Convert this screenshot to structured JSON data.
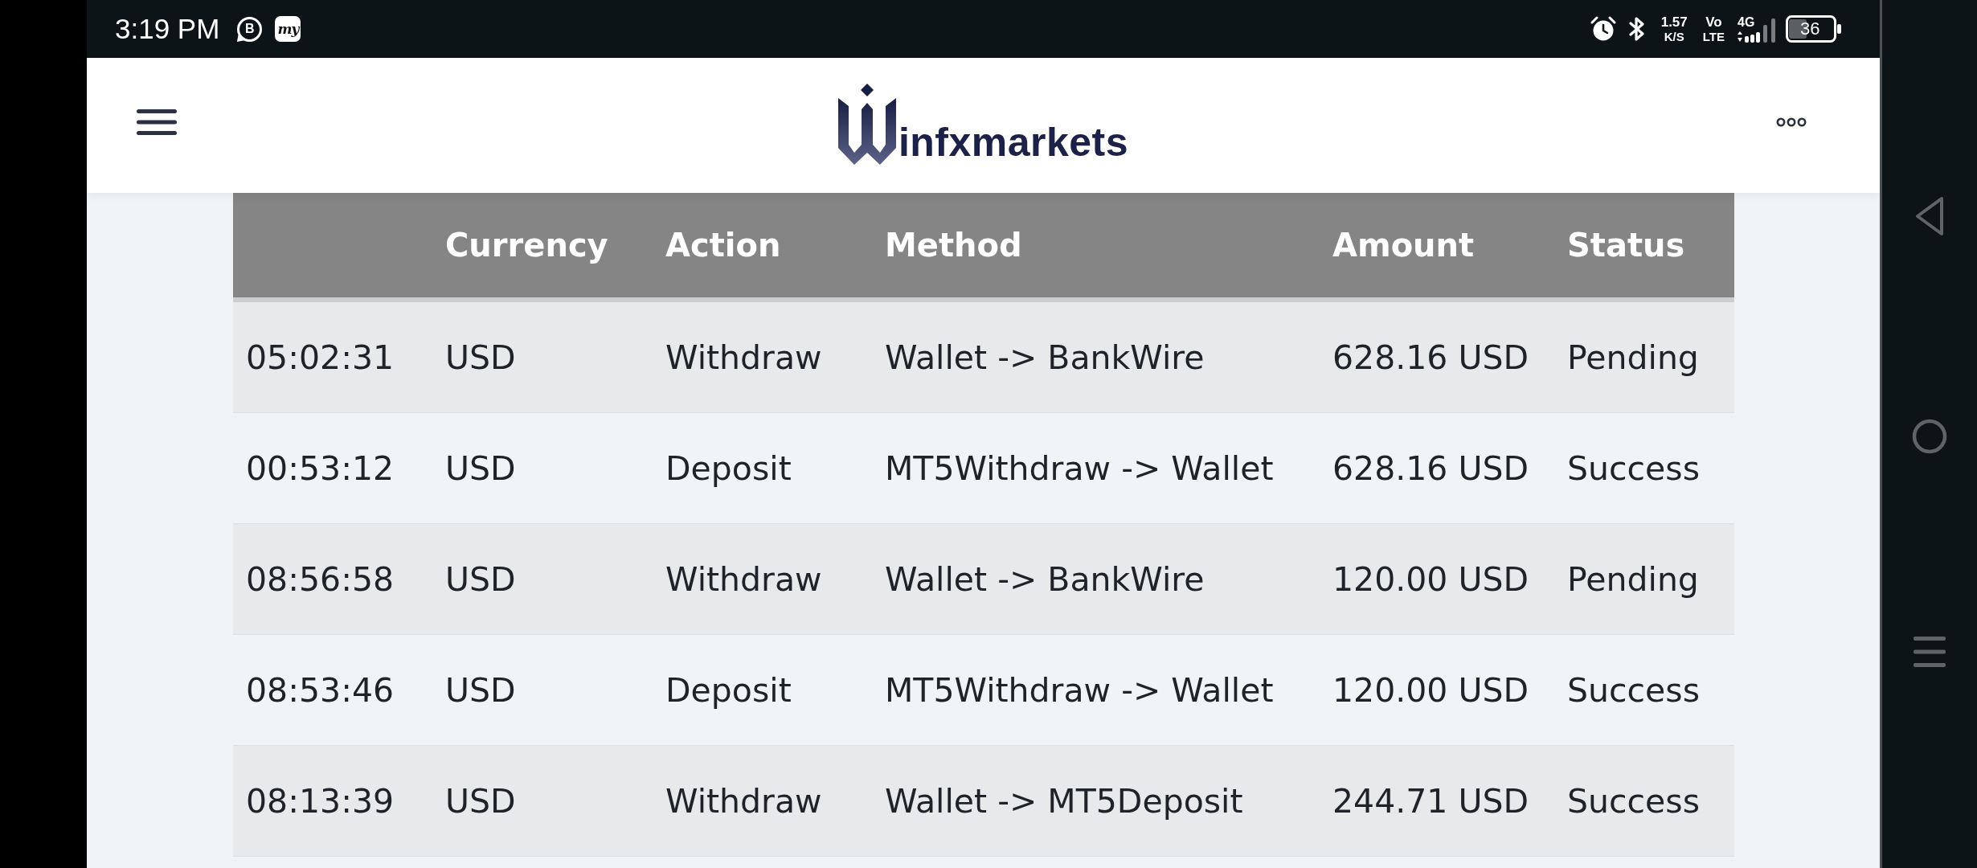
{
  "status_bar": {
    "time": "3:19 PM",
    "notifications": [
      {
        "kind": "chat",
        "glyph": "B"
      },
      {
        "kind": "tile",
        "glyph": "my"
      }
    ],
    "speed": {
      "value": "1.57",
      "unit": "K/S"
    },
    "volte": {
      "top": "Vo",
      "bottom": "LTE"
    },
    "network": "4G",
    "battery": "36"
  },
  "header": {
    "logo_text": "infxmarkets"
  },
  "table": {
    "columns": [
      "Currency",
      "Action",
      "Method",
      "Amount",
      "Status"
    ],
    "rows": [
      {
        "column_1": "05:02:31",
        "currency": "USD",
        "action": "Withdraw",
        "method": "Wallet -> BankWire",
        "amount": "628.16 USD",
        "status": "Pending"
      },
      {
        "column_1": "00:53:12",
        "currency": "USD",
        "action": "Deposit",
        "method": "MT5Withdraw -> Wallet",
        "amount": "628.16 USD",
        "status": "Success"
      },
      {
        "column_1": "08:56:58",
        "currency": "USD",
        "action": "Withdraw",
        "method": "Wallet -> BankWire",
        "amount": "120.00 USD",
        "status": "Pending"
      },
      {
        "column_1": "08:53:46",
        "currency": "USD",
        "action": "Deposit",
        "method": "MT5Withdraw -> Wallet",
        "amount": "120.00 USD",
        "status": "Success"
      },
      {
        "column_1": "08:13:39",
        "currency": "USD",
        "action": "Withdraw",
        "method": "Wallet -> MT5Deposit",
        "amount": "244.71 USD",
        "status": "Success"
      }
    ]
  }
}
